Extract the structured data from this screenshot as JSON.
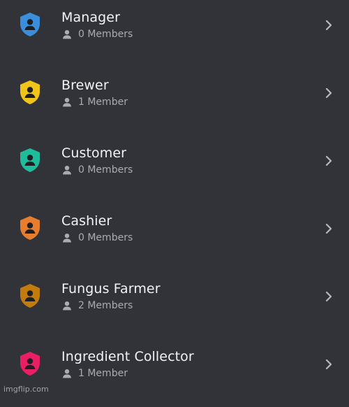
{
  "roles": [
    {
      "name": "Manager",
      "members": "0 Members",
      "color": "#3a8edb"
    },
    {
      "name": "Brewer",
      "members": "1 Member",
      "color": "#f0c419"
    },
    {
      "name": "Customer",
      "members": "0 Members",
      "color": "#1fbc9c"
    },
    {
      "name": "Cashier",
      "members": "0 Members",
      "color": "#e67e2e"
    },
    {
      "name": "Fungus Farmer",
      "members": "2 Members",
      "color": "#c27c0e"
    },
    {
      "name": "Ingredient Collector",
      "members": "1 Member",
      "color": "#e91e63"
    }
  ],
  "icons": {
    "role": "shield-person-icon",
    "members": "person-icon",
    "open": "chevron-right-icon"
  },
  "watermark": "imgflip.com"
}
